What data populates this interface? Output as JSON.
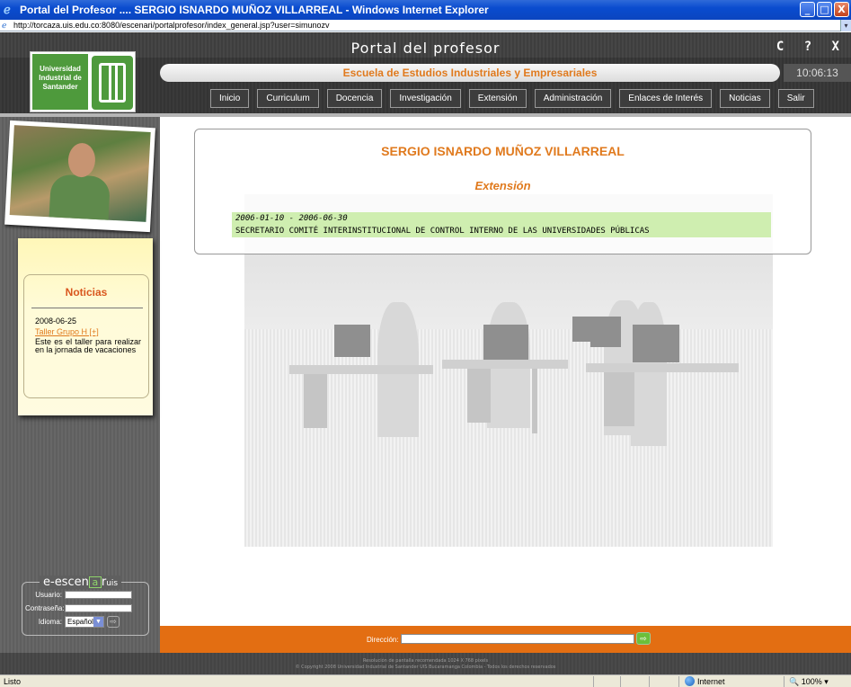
{
  "window": {
    "title": "Portal del Profesor .... SERGIO ISNARDO MUÑOZ VILLARREAL - Windows Internet Explorer",
    "url": "http://torcaza.uis.edu.co:8080/escenari/portalprofesor/index_general.jsp?user=simunozv",
    "controls": [
      "_",
      "□",
      "X"
    ]
  },
  "portal": {
    "title": "Portal del profesor",
    "top_icons": "C ? X",
    "logo_text": "Universidad Industrial de Santander",
    "school": "Escuela de Estudios Industriales y Empresariales",
    "clock": "10:06:13"
  },
  "nav": [
    {
      "label": "Inicio"
    },
    {
      "label": "Curriculum"
    },
    {
      "label": "Docencia"
    },
    {
      "label": "Investigación"
    },
    {
      "label": "Extensión"
    },
    {
      "label": "Administración"
    },
    {
      "label": "Enlaces de Interés"
    },
    {
      "label": "Noticias"
    },
    {
      "label": "Salir"
    }
  ],
  "news": {
    "title": "Noticias",
    "date": "2008-06-25",
    "link": "Taller Grupo H  [+]",
    "body": "Este es el taller para realizar en la jornada de vacaciones"
  },
  "login": {
    "brand_main": "e-escen",
    "brand_a": "a",
    "brand_r": "r",
    "brand_sub": "uis",
    "user_label": "Usuario:",
    "pass_label": "Contraseña:",
    "lang_label": "Idioma:",
    "lang_value": "Español"
  },
  "main": {
    "professor": "SERGIO ISNARDO MUÑOZ VILLARREAL",
    "section": "Extensión",
    "entry_dates": "2006-01-10 - 2006-06-30",
    "entry_desc": "SECRETARIO COMITÉ INTERINSTITUCIONAL DE CONTROL INTERNO DE LAS UNIVERSIDADES PÚBLICAS"
  },
  "direction": {
    "label": "Dirección:"
  },
  "footer": {
    "line1": "Resolución de pantalla recomendada 1024 X 768 pixels",
    "line2": "© Copyright 2008 Universidad Industrial de Santander UIS Bucaramanga Colombia - Todos los derechos reservados"
  },
  "status": {
    "text": "Listo",
    "zone": "Internet",
    "zoom": "100%"
  }
}
